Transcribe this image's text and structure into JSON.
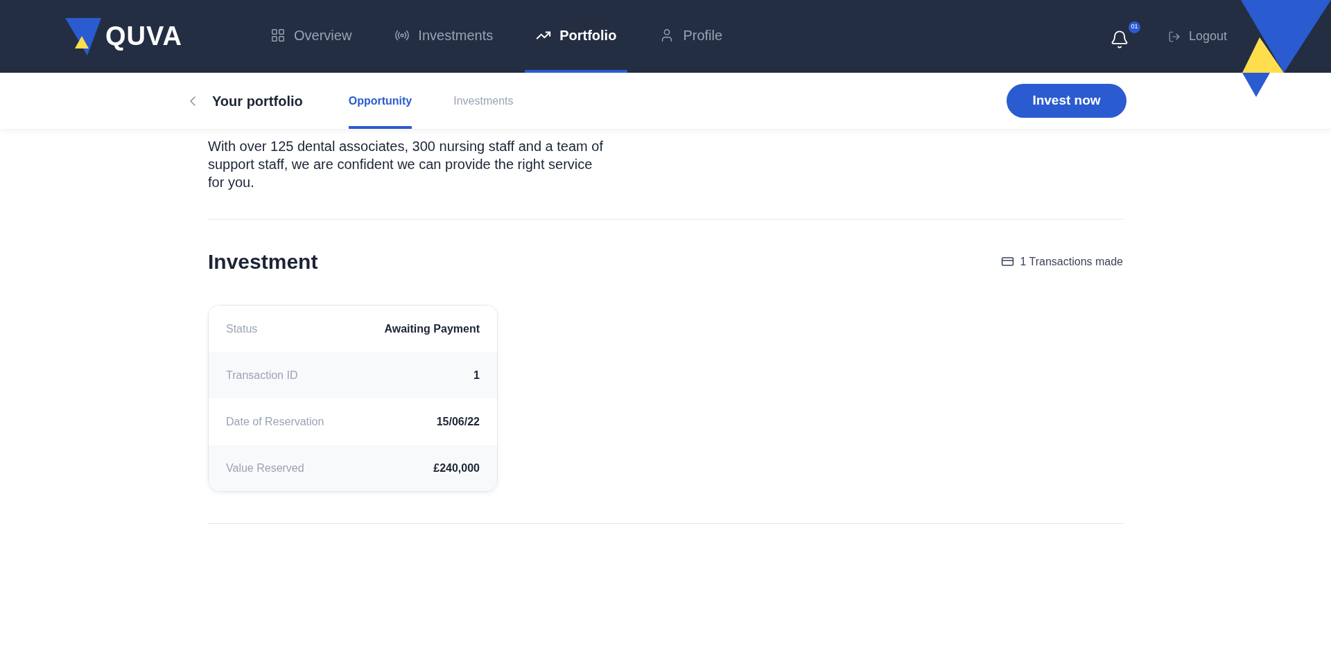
{
  "brand": {
    "name": "QUVA"
  },
  "nav": [
    {
      "label": "Overview",
      "selected": false
    },
    {
      "label": "Investments",
      "selected": false
    },
    {
      "label": "Portfolio",
      "selected": true
    },
    {
      "label": "Profile",
      "selected": false
    }
  ],
  "notifications": {
    "badge": "01"
  },
  "logout": "Logout",
  "subheader": {
    "title": "Your portfolio",
    "tabs": [
      {
        "label": "Opportunity",
        "selected": true
      },
      {
        "label": "Investments",
        "selected": false
      }
    ],
    "button": "Invest now"
  },
  "intro": "With over 125 dental associates, 300 nursing staff and a team of support staff, we are confident we can provide the right service for you.",
  "investment": {
    "heading": "Investment",
    "transactions": "1 Transactions made",
    "rows": [
      {
        "label": "Status",
        "value": "Awaiting Payment"
      },
      {
        "label": "Transaction ID",
        "value": "1"
      },
      {
        "label": "Date of Reservation",
        "value": "15/06/22"
      },
      {
        "label": "Value Reserved",
        "value": "£240,000"
      }
    ]
  }
}
